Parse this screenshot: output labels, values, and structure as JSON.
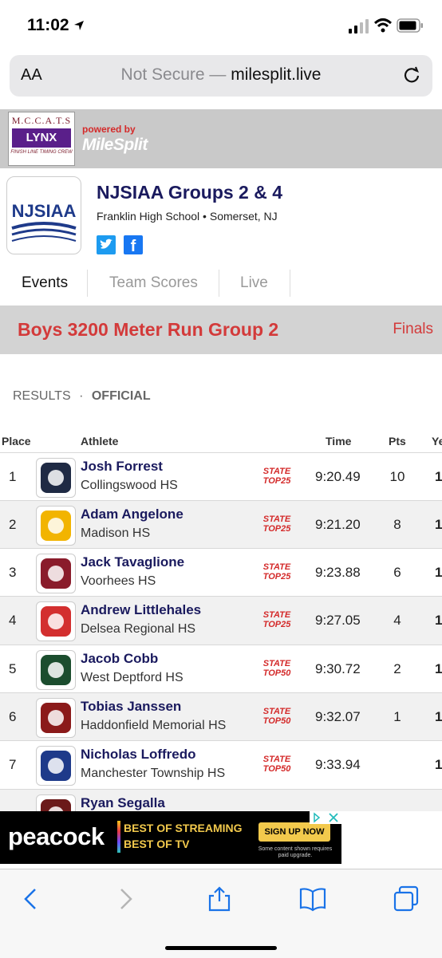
{
  "status": {
    "time": "11:02"
  },
  "browser": {
    "aa": "AA",
    "url_prefix": "Not Secure —",
    "url_domain": "milesplit.live"
  },
  "banner": {
    "lynx_line1": "M.C.C.A.T.S",
    "lynx_line2": "LYNX",
    "lynx_line3": "FINISH LINE TIMING CREW",
    "powered_by": "powered by",
    "brand": "MileSplit"
  },
  "meet": {
    "logo_text": "NJSIAA",
    "title": "NJSIAA Groups 2 & 4",
    "subtitle": "Franklin High School • Somerset, NJ"
  },
  "tabs": [
    {
      "label": "Events",
      "active": true
    },
    {
      "label": "Team Scores",
      "active": false
    },
    {
      "label": "Live",
      "active": false
    }
  ],
  "event": {
    "name": "Boys 3200 Meter Run Group 2",
    "round": "Finals"
  },
  "results": {
    "label": "RESULTS",
    "sep": "·",
    "status": "OFFICIAL"
  },
  "table": {
    "headers": {
      "place": "Place",
      "athlete": "Athlete",
      "time": "Time",
      "pts": "Pts",
      "year": "Ye"
    },
    "rows": [
      {
        "place": "1",
        "name": "Josh Forrest",
        "team": "Collingswood HS",
        "badge1": "STATE",
        "badge2": "TOP25",
        "time": "9:20.49",
        "pts": "10",
        "year": "1",
        "logo_color": "#1f2a44"
      },
      {
        "place": "2",
        "name": "Adam Angelone",
        "team": "Madison HS",
        "badge1": "STATE",
        "badge2": "TOP25",
        "time": "9:21.20",
        "pts": "8",
        "year": "1",
        "logo_color": "#f2b400"
      },
      {
        "place": "3",
        "name": "Jack Tavaglione",
        "team": "Voorhees HS",
        "badge1": "STATE",
        "badge2": "TOP25",
        "time": "9:23.88",
        "pts": "6",
        "year": "1",
        "logo_color": "#8a1c2b"
      },
      {
        "place": "4",
        "name": "Andrew Littlehales",
        "team": "Delsea Regional HS",
        "badge1": "STATE",
        "badge2": "TOP25",
        "time": "9:27.05",
        "pts": "4",
        "year": "1",
        "logo_color": "#d32f2f"
      },
      {
        "place": "5",
        "name": "Jacob Cobb",
        "team": "West Deptford HS",
        "badge1": "STATE",
        "badge2": "TOP50",
        "time": "9:30.72",
        "pts": "2",
        "year": "1",
        "logo_color": "#1b4d2e"
      },
      {
        "place": "6",
        "name": "Tobias Janssen",
        "team": "Haddonfield Memorial HS",
        "badge1": "STATE",
        "badge2": "TOP50",
        "time": "9:32.07",
        "pts": "1",
        "year": "1",
        "logo_color": "#8b1a1a"
      },
      {
        "place": "7",
        "name": "Nicholas Loffredo",
        "team": "Manchester Township HS",
        "badge1": "STATE",
        "badge2": "TOP50",
        "time": "9:33.94",
        "pts": "",
        "year": "1",
        "logo_color": "#1e3a8a"
      },
      {
        "place": "",
        "name": "Ryan Segalla",
        "team": "",
        "badge1": "",
        "badge2": "",
        "time": "",
        "pts": "",
        "year": "",
        "logo_color": "#6b1a1a"
      }
    ]
  },
  "ad": {
    "brand": "peacock",
    "line1": "BEST OF STREAMING",
    "line2": "BEST OF TV",
    "cta": "SIGN UP NOW",
    "note": "Some content shown requires paid upgrade."
  },
  "icons": {
    "back": "chevron-left-icon",
    "forward": "chevron-right-icon",
    "share": "share-icon",
    "bookmarks": "book-icon",
    "tabs": "tabs-icon"
  },
  "colors": {
    "accent": "#d33a3a",
    "athlete_name": "#1a1a5e",
    "badge": "#d42a2a"
  }
}
